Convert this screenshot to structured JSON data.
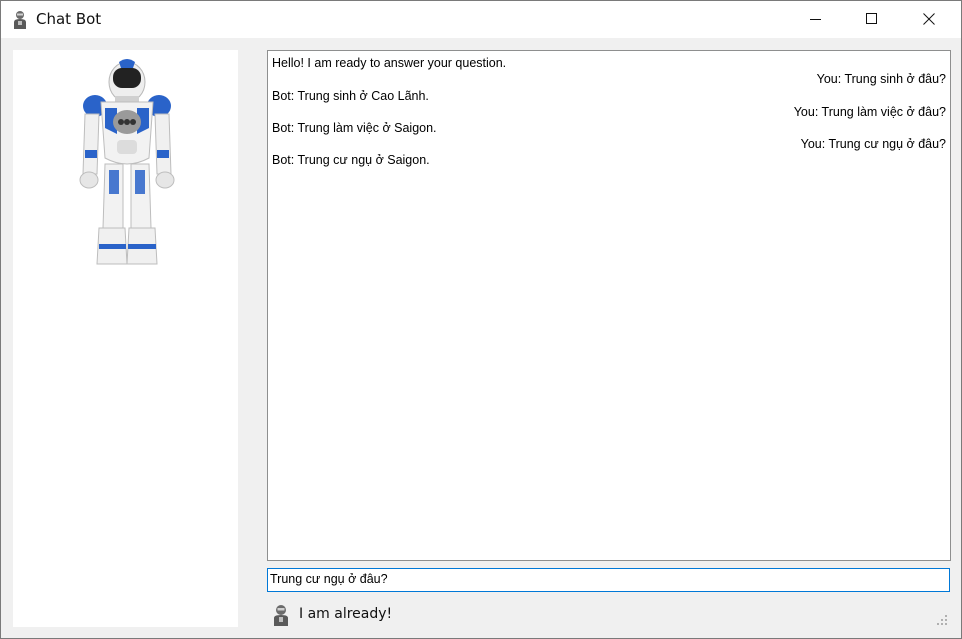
{
  "window": {
    "title": "Chat Bot",
    "icon": "robot-icon"
  },
  "controls": {
    "minimize_icon": "minimize-icon",
    "maximize_icon": "maximize-icon",
    "close_icon": "close-icon"
  },
  "chat": {
    "messages": [
      {
        "sender": "bot",
        "text": "Hello! I am ready to answer your question."
      },
      {
        "sender": "you",
        "text": "You: Trung sinh ở đâu?"
      },
      {
        "sender": "bot",
        "text": "Bot: Trung sinh ở Cao Lãnh."
      },
      {
        "sender": "you",
        "text": "You: Trung làm việc ở đâu?"
      },
      {
        "sender": "bot",
        "text": "Bot: Trung làm việc ở Saigon."
      },
      {
        "sender": "you",
        "text": "You: Trung cư ngụ ở đâu?"
      },
      {
        "sender": "bot",
        "text": "Bot: Trung cư ngụ ở Saigon."
      }
    ]
  },
  "input": {
    "value": "Trung cư ngụ ở đâu?"
  },
  "status": {
    "text": "I am already!",
    "icon": "robot-icon"
  },
  "colors": {
    "accent": "#0078d7",
    "robot_blue": "#2a63c9"
  }
}
